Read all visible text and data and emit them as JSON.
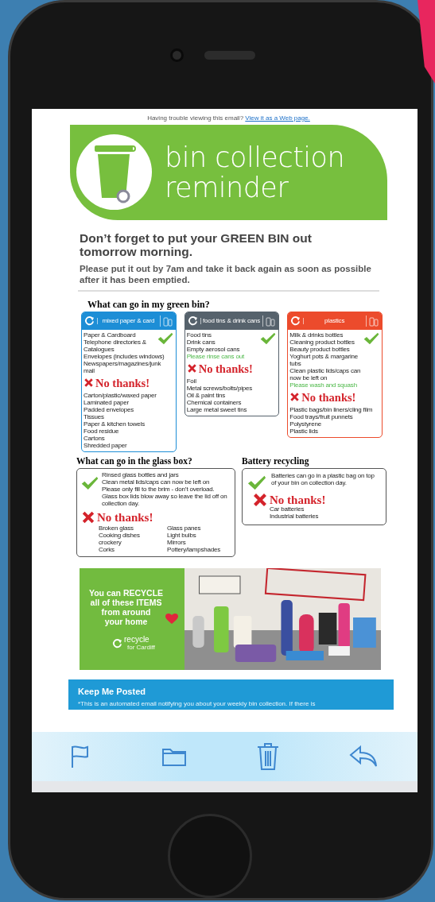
{
  "notice": {
    "text": "Having trouble viewing this email?",
    "link": "View it as a Web page."
  },
  "header": {
    "title": "bin collection reminder"
  },
  "headline": "Don’t forget to put your GREEN BIN out tomorrow morning.",
  "subtext": "Please put it out by 7am and take it back again as soon as possible after it has been emptied.",
  "green_bin": {
    "heading": "What can go in my green bin?",
    "bins": [
      {
        "label": "mixed paper & card",
        "color": "#1d8ed6",
        "yes": [
          "Paper & Cardboard",
          "Telephone directories & Catalogues",
          "Envelopes (includes windows)",
          "Newspapers/magazines/junk mail"
        ],
        "no_label": "No thanks!",
        "no": [
          "Carton/plastic/waxed paper",
          "Laminated paper",
          "Padded envelopes",
          "Tissues",
          "Paper & kitchen towels",
          "Food residue",
          "Cartons",
          "Shredded paper"
        ]
      },
      {
        "label": "food tins & drink cans",
        "color": "#56626c",
        "yes": [
          "Food tins",
          "Drink cans",
          "Empty aerosol cans"
        ],
        "note": "Please rinse cans out",
        "no_label": "No thanks!",
        "no": [
          "Foil",
          "Metal screws/bolts/pipes",
          "Oil & paint tins",
          "Chemical containers",
          "Large metal sweet tins"
        ]
      },
      {
        "label": "plastics",
        "color": "#ec4b2c",
        "yes": [
          "Milk & drinks bottles",
          "Cleaning product bottles",
          "Beauty product bottles",
          "Yoghurt pots & margarine tubs",
          "Clean plastic lids/caps can now be left on"
        ],
        "note": "Please wash and squash",
        "no_label": "No thanks!",
        "no": [
          "Plastic bags/bin liners/cling film",
          "Food trays/fruit punnets",
          "Polystyrene",
          "Plastic lids"
        ]
      }
    ]
  },
  "glass_box": {
    "heading": "What can go in the glass box?",
    "yes": [
      "Rinsed glass bottles and jars",
      "Clean metal lids/caps can now be left on",
      "Please only fill to the brim - don’t overload.",
      "Glass box lids blow away so leave the lid off on collection day."
    ],
    "no_label": "No thanks!",
    "no_columns": [
      [
        "Broken glass",
        "Cooking dishes crockery",
        "Corks"
      ],
      [
        "Glass panes",
        "Light bulbs",
        "Mirrors",
        "Pottery/lampshades"
      ]
    ]
  },
  "battery": {
    "heading": "Battery recycling",
    "yes": [
      "Batteries can go in a plastic bag on top of your bin on collection day."
    ],
    "no_label": "No thanks!",
    "no": [
      "Car batteries",
      "Industrial batteries"
    ]
  },
  "banner": {
    "lines": [
      "You can **RECYCLE**",
      "all of these **ITEMS**",
      "from around",
      "your home"
    ],
    "logo": "recycle",
    "logo_sub": "for Cardiff"
  },
  "footer": {
    "heading": "Keep Me Posted",
    "text": "*This is an automated email notifying you about your weekly bin collection. If there is"
  }
}
